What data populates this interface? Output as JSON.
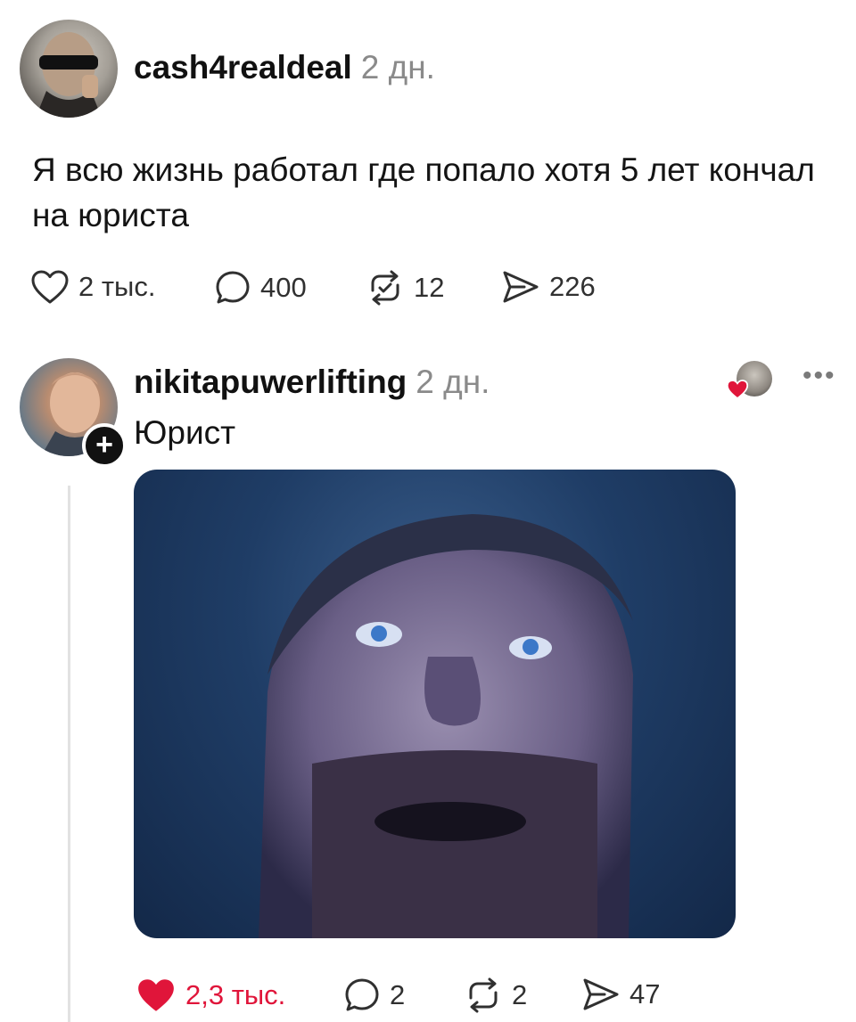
{
  "post1": {
    "username": "cash4realdeal",
    "timestamp": "2 дн.",
    "text": "Я всю жизнь работал где попало хотя 5 лет кончал на юриста",
    "actions": {
      "likes": "2 тыс.",
      "replies": "400",
      "reposts": "12",
      "shares": "226"
    }
  },
  "post2": {
    "username": "nikitapuwerlifting",
    "timestamp": "2 дн.",
    "text": "Юрист",
    "follow_symbol": "+",
    "more_symbol": "•••",
    "liked": true,
    "actions": {
      "likes": "2,3 тыс.",
      "replies": "2",
      "reposts": "2",
      "shares": "47"
    }
  },
  "colors": {
    "text": "#111111",
    "muted": "#8a8a8a",
    "like_active": "#e0153a",
    "thread_line": "#e2e2e2"
  },
  "icons": {
    "like": "heart-icon",
    "reply": "comment-icon",
    "repost": "repost-icon",
    "share": "share-icon",
    "more": "more-icon",
    "follow": "plus-icon"
  }
}
